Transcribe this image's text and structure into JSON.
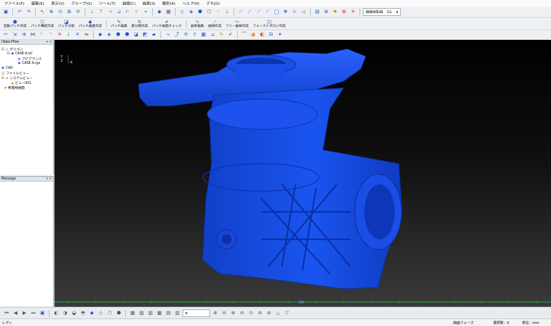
{
  "menu": [
    "ファイル(F)",
    "編集(E)",
    "表示(V)",
    "グループ(G)",
    "ツール(T)",
    "曲線(C)",
    "曲面(S)",
    "解析(A)",
    "ヘルプ(H)",
    "デモ(D)"
  ],
  "toolbar": {
    "surface_combo_label": "曲線目影曲",
    "surface_combo_value": "G1",
    "row2_buttons": [
      "自動パッチ作成",
      "パッチ構成作成",
      "パッチ分割",
      "パッチ曲面作成",
      "パッチ編集",
      "部分再作成",
      "パッチ曲面チェック",
      "曲率編集",
      "曲線作成",
      "フリー曲線作成",
      "フェーストポロジ作成"
    ]
  },
  "object_tree": {
    "title": "ObjectTree",
    "controls": "▾ ✕",
    "items": {
      "polygon": "ポリゴン",
      "case_stl": "CASE A.stl",
      "appearance": "アピアランス",
      "case_rgs": "CASE A.rgs",
      "cad": "CAD",
      "file_view": "ファイルビュー",
      "system_view": "システムビュー",
      "view001": "ビュー001",
      "section_curve": "断面線曲面"
    }
  },
  "message_panel": {
    "title": "Message",
    "controls": "▾ ✕"
  },
  "viewport": {
    "axis_y": "Y",
    "axis_z": "Z",
    "axis_x": "X",
    "ruler_center": "180"
  },
  "status": {
    "ready": "レディ",
    "phase": "曲面フェーズ",
    "selected": "選択数：0",
    "unit": "単位：mm"
  }
}
